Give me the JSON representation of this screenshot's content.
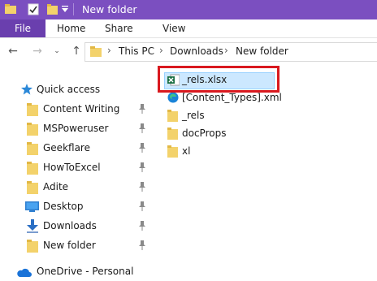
{
  "window": {
    "title": "New folder",
    "accent_color": "#7b4fc0"
  },
  "ribbon": {
    "tabs": [
      "File",
      "Home",
      "Share",
      "View"
    ]
  },
  "address": {
    "crumbs": [
      "This PC",
      "Downloads",
      "New folder"
    ]
  },
  "sidebar": {
    "quick_access_label": "Quick access",
    "items": [
      {
        "label": "Content Writing",
        "icon": "folder-icon",
        "pinned": true
      },
      {
        "label": "MSPoweruser",
        "icon": "folder-icon",
        "pinned": true
      },
      {
        "label": "Geekflare",
        "icon": "folder-icon",
        "pinned": true
      },
      {
        "label": "HowToExcel",
        "icon": "folder-icon",
        "pinned": true
      },
      {
        "label": "Adite",
        "icon": "folder-icon",
        "pinned": true
      },
      {
        "label": "Desktop",
        "icon": "desktop-icon",
        "pinned": true
      },
      {
        "label": "Downloads",
        "icon": "download-arrow-icon",
        "pinned": true
      },
      {
        "label": "New folder",
        "icon": "folder-icon",
        "pinned": true
      }
    ],
    "onedrive_label": "OneDrive - Personal"
  },
  "files": [
    {
      "name": "_rels.xlsx",
      "icon": "excel-file-icon",
      "selected": true
    },
    {
      "name": "[Content_Types].xml",
      "icon": "edge-xml-icon",
      "selected": false
    },
    {
      "name": "_rels",
      "icon": "folder-icon",
      "selected": false
    },
    {
      "name": "docProps",
      "icon": "folder-icon",
      "selected": false
    },
    {
      "name": "xl",
      "icon": "folder-icon",
      "selected": false
    }
  ]
}
